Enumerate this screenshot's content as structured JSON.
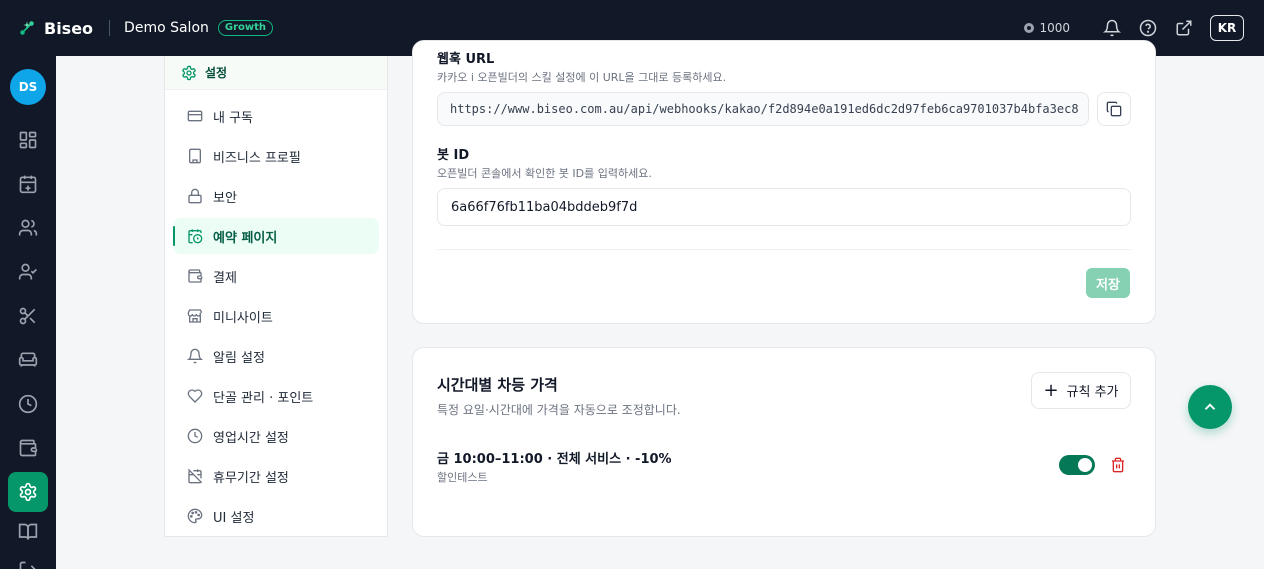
{
  "topbar": {
    "brand": "Biseo",
    "org_name": "Demo Salon",
    "plan_badge": "Growth",
    "credit": "1000",
    "lang": "KR",
    "icons": [
      "bell-icon",
      "help-icon",
      "external-link-icon"
    ]
  },
  "rail": {
    "avatar": "DS",
    "icons": [
      "dashboard-icon",
      "calendar-plus-icon",
      "users-icon",
      "user-check-icon",
      "scissors-icon",
      "sofa-icon",
      "clock-icon",
      "wallet-icon",
      "settings-icon",
      "book-icon",
      "logout-icon"
    ],
    "active": "settings-icon"
  },
  "settings_nav": {
    "header": "설정",
    "items": [
      {
        "label": "내 구독",
        "icon": "card-icon"
      },
      {
        "label": "비즈니스 프로필",
        "icon": "building-icon"
      },
      {
        "label": "보안",
        "icon": "lock-icon"
      },
      {
        "label": "예약 페이지",
        "icon": "calendar-clock-icon",
        "active": true
      },
      {
        "label": "결제",
        "icon": "wallet-icon"
      },
      {
        "label": "미니사이트",
        "icon": "store-icon"
      },
      {
        "label": "알림 설정",
        "icon": "bell-icon"
      },
      {
        "label": "단골 관리 · 포인트",
        "icon": "heart-icon"
      },
      {
        "label": "영업시간 설정",
        "icon": "clock-icon"
      },
      {
        "label": "휴무기간 설정",
        "icon": "calendar-off-icon"
      },
      {
        "label": "UI 설정",
        "icon": "palette-icon"
      }
    ]
  },
  "kakao_card": {
    "webhook_label": "웹훅 URL",
    "webhook_help": "카카오 i 오픈빌더의 스킬 설정에 이 URL을 그대로 등록하세요.",
    "webhook_url": "https://www.biseo.com.au/api/webhooks/kakao/f2d894e0a191ed6dc2d97feb6ca9701037b4bfa3ec8",
    "bot_id_label": "봇 ID",
    "bot_id_help": "오픈빌더 콘솔에서 확인한 봇 ID를 입력하세요.",
    "bot_id_value": "6a66f76fb11ba04bddeb9f7d",
    "save_label": "저장"
  },
  "pricing_card": {
    "title": "시간대별 차등 가격",
    "description": "특정 요일·시간대에 가격을 자동으로 조정합니다.",
    "add_label": "규칙 추가",
    "rules": [
      {
        "title": "금 10:00–11:00 · 전체 서비스 · -10%",
        "subtitle": "할인테스트",
        "enabled": true
      }
    ]
  },
  "colors": {
    "accent": "#059669",
    "dark": "#111827",
    "danger": "#dc2626"
  }
}
